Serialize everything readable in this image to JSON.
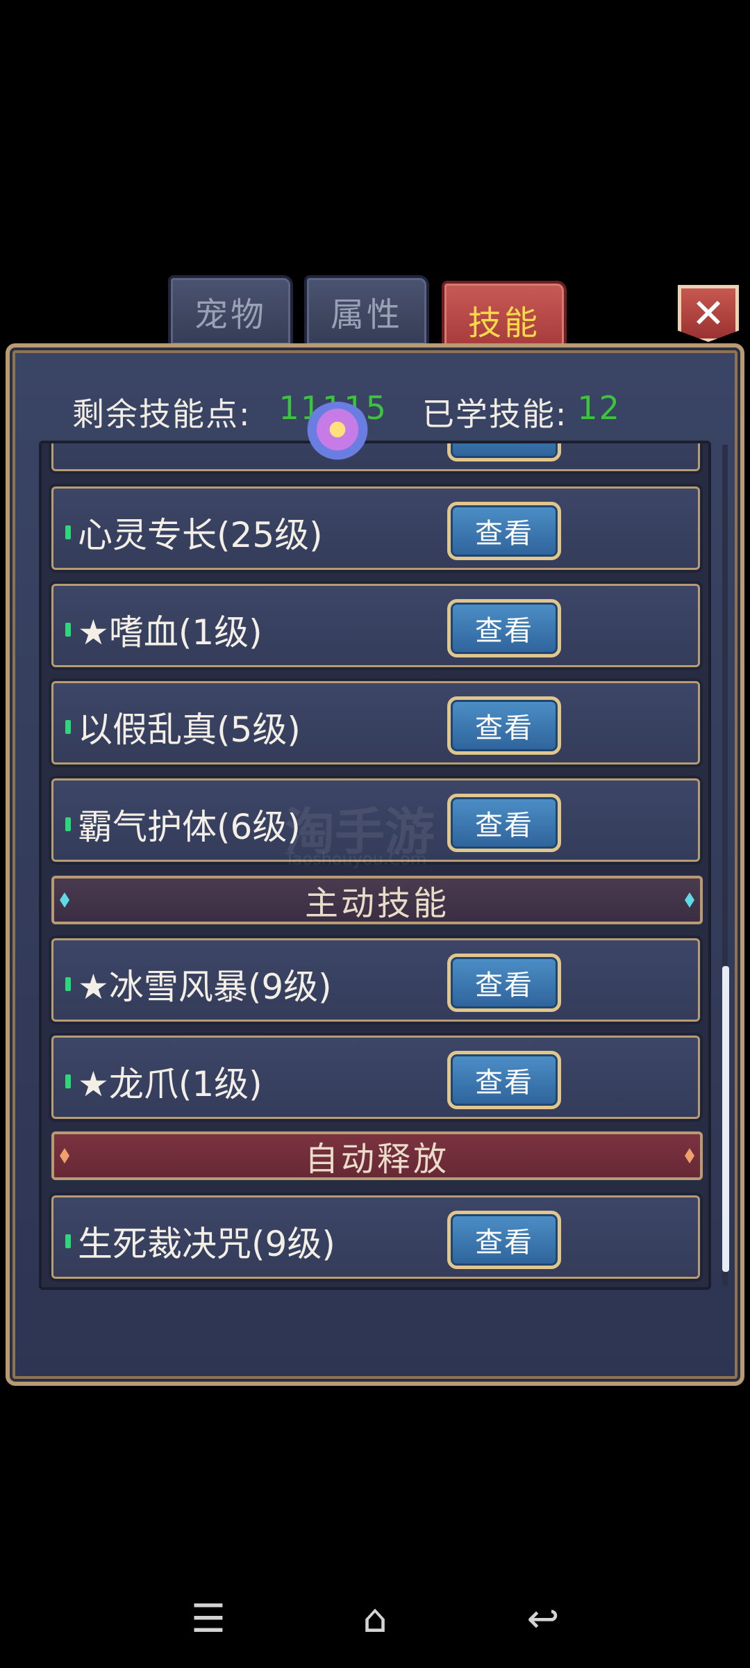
{
  "tabs": [
    {
      "label": "宠物",
      "active": false
    },
    {
      "label": "属性",
      "active": false
    },
    {
      "label": "技能",
      "active": true
    }
  ],
  "close_label": "✕",
  "header": {
    "remaining_label": "剩余技能点:",
    "remaining_value": "11115",
    "learned_label": "已学技能:",
    "learned_value": "12"
  },
  "skills_passive": [
    {
      "name": "心灵专长(25级)",
      "button": "查看"
    },
    {
      "name": "★嗜血(1级)",
      "button": "查看"
    },
    {
      "name": "以假乱真(5级)",
      "button": "查看"
    },
    {
      "name": "霸气护体(6级)",
      "button": "查看"
    }
  ],
  "section_active": "主动技能",
  "skills_active": [
    {
      "name": "★冰雪风暴(9级)",
      "button": "查看"
    },
    {
      "name": "★龙爪(1级)",
      "button": "查看"
    }
  ],
  "section_auto": "自动释放",
  "skills_auto": [
    {
      "name": "生死裁决咒(9级)",
      "button": "查看"
    }
  ],
  "watermark": {
    "main": "淘手游",
    "sub": "Taoshouyou.Com"
  },
  "nav": {
    "menu_icon": "☰",
    "home_icon": "⌂",
    "back_icon": "↩"
  },
  "colors": {
    "accent_green": "#3cc43c",
    "active_tab": "#b0443f",
    "tab_text_active": "#f7d94a"
  }
}
